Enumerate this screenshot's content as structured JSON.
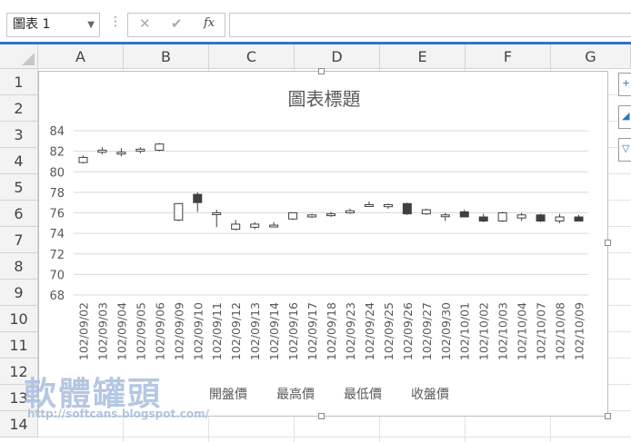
{
  "formula_bar": {
    "name_box": "圖表 1",
    "separator": "⋮",
    "cancel_glyph": "✕",
    "enter_glyph": "✔",
    "function_glyph": "fx"
  },
  "columns": [
    "A",
    "B",
    "C",
    "D",
    "E",
    "F",
    "G"
  ],
  "rows": [
    "1",
    "2",
    "3",
    "4",
    "5",
    "6",
    "7",
    "8",
    "9",
    "10",
    "11",
    "12",
    "13",
    "14"
  ],
  "chart": {
    "title": "圖表標題",
    "legend": [
      "開盤價",
      "最高價",
      "最低價",
      "收盤價"
    ]
  },
  "chart_data": {
    "type": "stock",
    "title": "圖表標題",
    "ylim": [
      68,
      84
    ],
    "yticks": [
      68,
      70,
      72,
      74,
      76,
      78,
      80,
      82,
      84
    ],
    "grid": true,
    "legend_position": "bottom",
    "series_names": [
      "開盤價",
      "最高價",
      "最低價",
      "收盤價"
    ],
    "categories": [
      "102/09/02",
      "102/09/03",
      "102/09/04",
      "102/09/05",
      "102/09/06",
      "102/09/09",
      "102/09/10",
      "102/09/11",
      "102/09/12",
      "102/09/13",
      "102/09/14",
      "102/09/16",
      "102/09/17",
      "102/09/18",
      "102/09/23",
      "102/09/24",
      "102/09/25",
      "102/09/26",
      "102/09/27",
      "102/09/30",
      "102/10/01",
      "102/10/02",
      "102/10/03",
      "102/10/04",
      "102/10/07",
      "102/10/08",
      "102/10/09"
    ],
    "open": [
      80.9,
      81.9,
      81.9,
      82.0,
      82.1,
      75.3,
      77.8,
      76.0,
      74.4,
      74.6,
      74.8,
      75.4,
      75.6,
      75.8,
      76.0,
      76.8,
      76.6,
      76.9,
      75.9,
      75.8,
      76.1,
      75.6,
      75.2,
      75.5,
      75.8,
      75.2,
      75.6
    ],
    "high": [
      81.6,
      82.4,
      82.3,
      82.4,
      82.8,
      76.9,
      78.0,
      76.3,
      75.3,
      75.1,
      75.1,
      76.0,
      75.9,
      76.1,
      76.4,
      77.1,
      76.9,
      77.0,
      76.4,
      76.0,
      76.3,
      75.9,
      76.1,
      76.0,
      75.9,
      75.9,
      75.8
    ],
    "low": [
      80.8,
      81.7,
      81.5,
      81.8,
      82.0,
      75.2,
      76.1,
      74.6,
      74.3,
      74.4,
      74.7,
      75.3,
      75.5,
      75.6,
      75.9,
      76.6,
      76.4,
      75.8,
      75.8,
      75.2,
      75.6,
      75.1,
      75.1,
      75.2,
      75.1,
      75.0,
      75.2
    ],
    "close": [
      81.4,
      82.1,
      81.9,
      82.2,
      82.7,
      76.9,
      77.0,
      76.0,
      74.9,
      74.9,
      74.8,
      76.0,
      75.8,
      75.9,
      76.2,
      76.8,
      76.8,
      75.9,
      76.3,
      75.8,
      75.6,
      75.2,
      76.0,
      75.8,
      75.2,
      75.6,
      75.2
    ]
  },
  "watermark": {
    "text": "軟體罐頭",
    "url": "http://softcans.blogspot.com/"
  }
}
